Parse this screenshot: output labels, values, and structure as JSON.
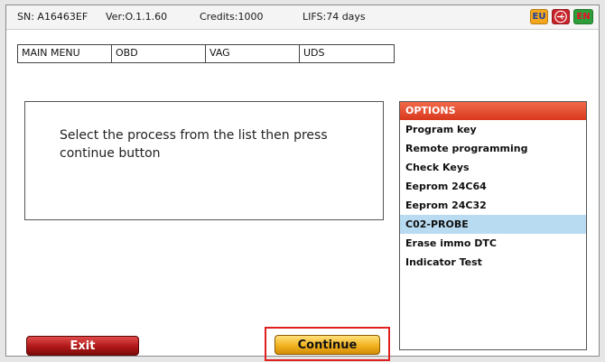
{
  "status": {
    "serial": "SN: A16463EF",
    "version": "Ver:O.1.1.60",
    "credits": "Credits:1000",
    "lifs": "LIFS:74 days"
  },
  "flags": {
    "eu": "EU",
    "en": "EN",
    "usb_icon": "usb-icon"
  },
  "breadcrumb": [
    "MAIN MENU",
    "OBD",
    "VAG",
    "UDS"
  ],
  "message": "Select the process from the list then press continue button",
  "options": {
    "header": "OPTIONS",
    "items": [
      "Program key",
      "Remote programming",
      "Check Keys",
      "Eeprom 24C64",
      "Eeprom 24C32",
      "C02-PROBE",
      "Erase immo DTC",
      "Indicator Test"
    ],
    "selected": "C02-PROBE"
  },
  "buttons": {
    "exit": "Exit",
    "continue": "Continue"
  },
  "colors": {
    "options_header": "#e04a2a",
    "selected_row": "#b8dbf2",
    "exit_button": "#b01818",
    "continue_button": "#f1b21f",
    "highlight_border": "#e02020"
  }
}
